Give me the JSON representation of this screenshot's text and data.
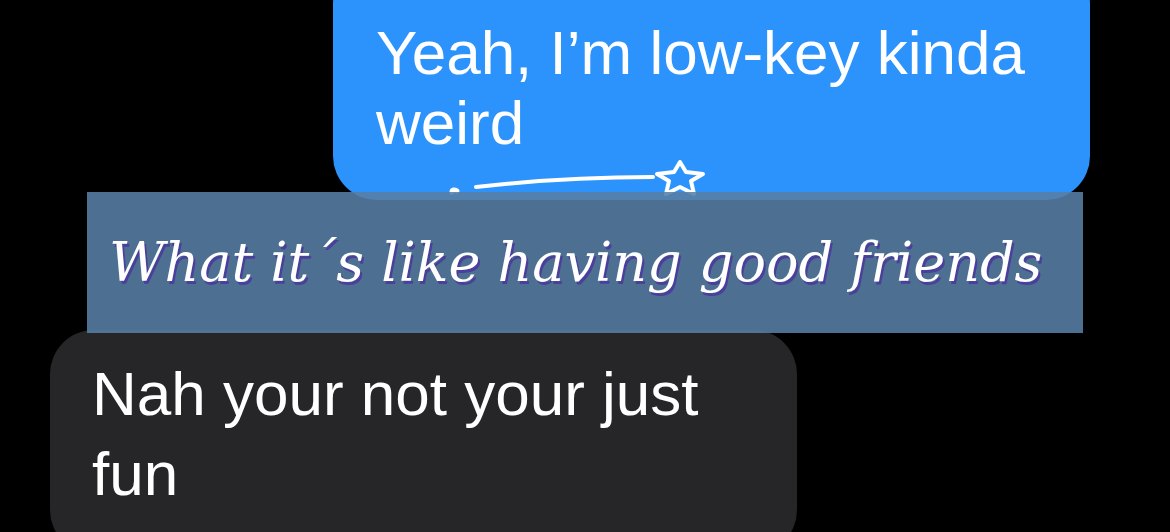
{
  "thread": [
    {
      "kind": "outgoing",
      "text": "Yeah, I’m low-key kinda weird"
    },
    {
      "kind": "incoming",
      "text": "Nah your not your just fun"
    }
  ],
  "caption": {
    "text": "What it´s like having good friends"
  }
}
